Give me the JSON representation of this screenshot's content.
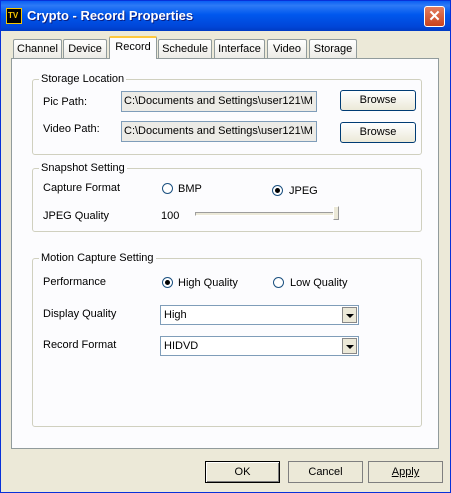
{
  "window": {
    "title": "Crypto - Record Properties",
    "app_icon_text": "TV"
  },
  "tabs": [
    {
      "label": "Channel"
    },
    {
      "label": "Device"
    },
    {
      "label": "Record"
    },
    {
      "label": "Schedule"
    },
    {
      "label": "Interface"
    },
    {
      "label": "Video"
    },
    {
      "label": "Storage"
    }
  ],
  "active_tab": "Record",
  "storage_location": {
    "title": "Storage Location",
    "pic_path_label": "Pic Path:",
    "pic_path_value": "C:\\Documents and Settings\\user121\\M",
    "video_path_label": "Video Path:",
    "video_path_value": "C:\\Documents and Settings\\user121\\M",
    "browse_label": "Browse"
  },
  "snapshot": {
    "title": "Snapshot Setting",
    "capture_format_label": "Capture Format",
    "bmp_label": "BMP",
    "jpeg_label": "JPEG",
    "selected": "JPEG",
    "jpeg_quality_label": "JPEG Quality",
    "jpeg_quality_value": "100"
  },
  "motion": {
    "title": "Motion Capture Setting",
    "performance_label": "Performance",
    "high_quality_label": "High Quality",
    "low_quality_label": "Low Quality",
    "selected": "High Quality",
    "display_quality_label": "Display Quality",
    "display_quality_value": "High",
    "record_format_label": "Record Format",
    "record_format_value": "HIDVD"
  },
  "buttons": {
    "ok": "OK",
    "cancel": "Cancel",
    "apply": "Apply"
  },
  "colors": {
    "titlebar": "#0058ee",
    "face": "#ece9d8",
    "close": "#c8421d",
    "active_tab_accent": "#ffc83c"
  }
}
